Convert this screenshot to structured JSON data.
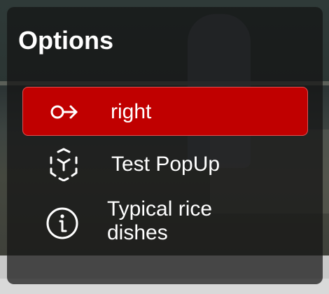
{
  "menu": {
    "title": "Options",
    "items": [
      {
        "label": "right",
        "icon": "arrow-right-circle-icon",
        "active": true
      },
      {
        "label": "Test PopUp",
        "icon": "scan-cube-icon",
        "active": false
      },
      {
        "label": "Typical rice\ndishes",
        "icon": "info-circle-icon",
        "active": false
      }
    ]
  },
  "colors": {
    "active_item_bg": "#c00000",
    "menu_bg": "rgba(20,20,20,0.72)",
    "text": "#ffffff"
  }
}
